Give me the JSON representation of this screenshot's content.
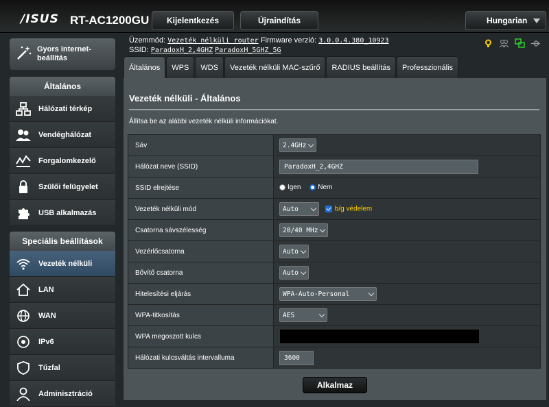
{
  "header": {
    "brand": "/ISUS",
    "model": "RT-AC1200GU",
    "logout_label": "Kijelentkezés",
    "reboot_label": "Újraindítás",
    "language": "Hungarian"
  },
  "info": {
    "mode_label": "Üzemmód:",
    "mode_value": "Vezeték nélküli router",
    "firmware_label": "Firmware verzió:",
    "firmware_value": "3.0.0.4.380_10923",
    "ssid_label": "SSID:",
    "ssid_24": "ParadoxH_2,4GHZ",
    "ssid_5": "ParadoxH_5GHZ_5G"
  },
  "sidebar": {
    "quick_setup": "Gyors internet-beállítás",
    "general_title": "Általános",
    "general_items": [
      {
        "label": "Hálózati térkép",
        "icon": "network-map-icon"
      },
      {
        "label": "Vendéghálózat",
        "icon": "guest-network-icon"
      },
      {
        "label": "Forgalomkezelő",
        "icon": "traffic-manager-icon"
      },
      {
        "label": "Szülői felügyelet",
        "icon": "parental-control-icon"
      },
      {
        "label": "USB alkalmazás",
        "icon": "usb-app-icon"
      }
    ],
    "advanced_title": "Speciális beállítások",
    "advanced_items": [
      {
        "label": "Vezeték nélküli",
        "icon": "wireless-icon"
      },
      {
        "label": "LAN",
        "icon": "lan-icon"
      },
      {
        "label": "WAN",
        "icon": "wan-icon"
      },
      {
        "label": "IPv6",
        "icon": "ipv6-icon"
      },
      {
        "label": "Tűzfal",
        "icon": "firewall-icon"
      },
      {
        "label": "Adminisztráció",
        "icon": "administration-icon"
      }
    ]
  },
  "tabs": [
    "Általános",
    "WPS",
    "WDS",
    "Vezeték nélküli MAC-szűrő",
    "RADIUS beállítás",
    "Professzionális"
  ],
  "main": {
    "title": "Vezeték nélküli - Általános",
    "description": "Állítsa be az alábbi vezeték nélküli információkat.",
    "rows": {
      "band": {
        "label": "Sáv",
        "value": "2.4GHz"
      },
      "ssid": {
        "label": "Hálózat neve (SSID)",
        "value": "ParadoxH_2,4GHZ"
      },
      "hide_ssid": {
        "label": "SSID elrejtése",
        "yes": "Igen",
        "no": "Nem"
      },
      "mode": {
        "label": "Vezeték nélküli mód",
        "value": "Auto",
        "bg_protection": "b/g védelem"
      },
      "bandwidth": {
        "label": "Csatorna sávszélesség",
        "value": "20/40 MHz"
      },
      "control_channel": {
        "label": "Vezérlőcsatorna",
        "value": "Auto"
      },
      "ext_channel": {
        "label": "Bővítő csatorna",
        "value": "Auto"
      },
      "auth": {
        "label": "Hitelesítési eljárás",
        "value": "WPA-Auto-Personal"
      },
      "encryption": {
        "label": "WPA-titkosítás",
        "value": "AES"
      },
      "psk": {
        "label": "WPA megoszott kulcs"
      },
      "rotation": {
        "label": "Hálózati kulcsváltás intervalluma",
        "value": "3600"
      }
    },
    "apply_label": "Alkalmaz"
  }
}
